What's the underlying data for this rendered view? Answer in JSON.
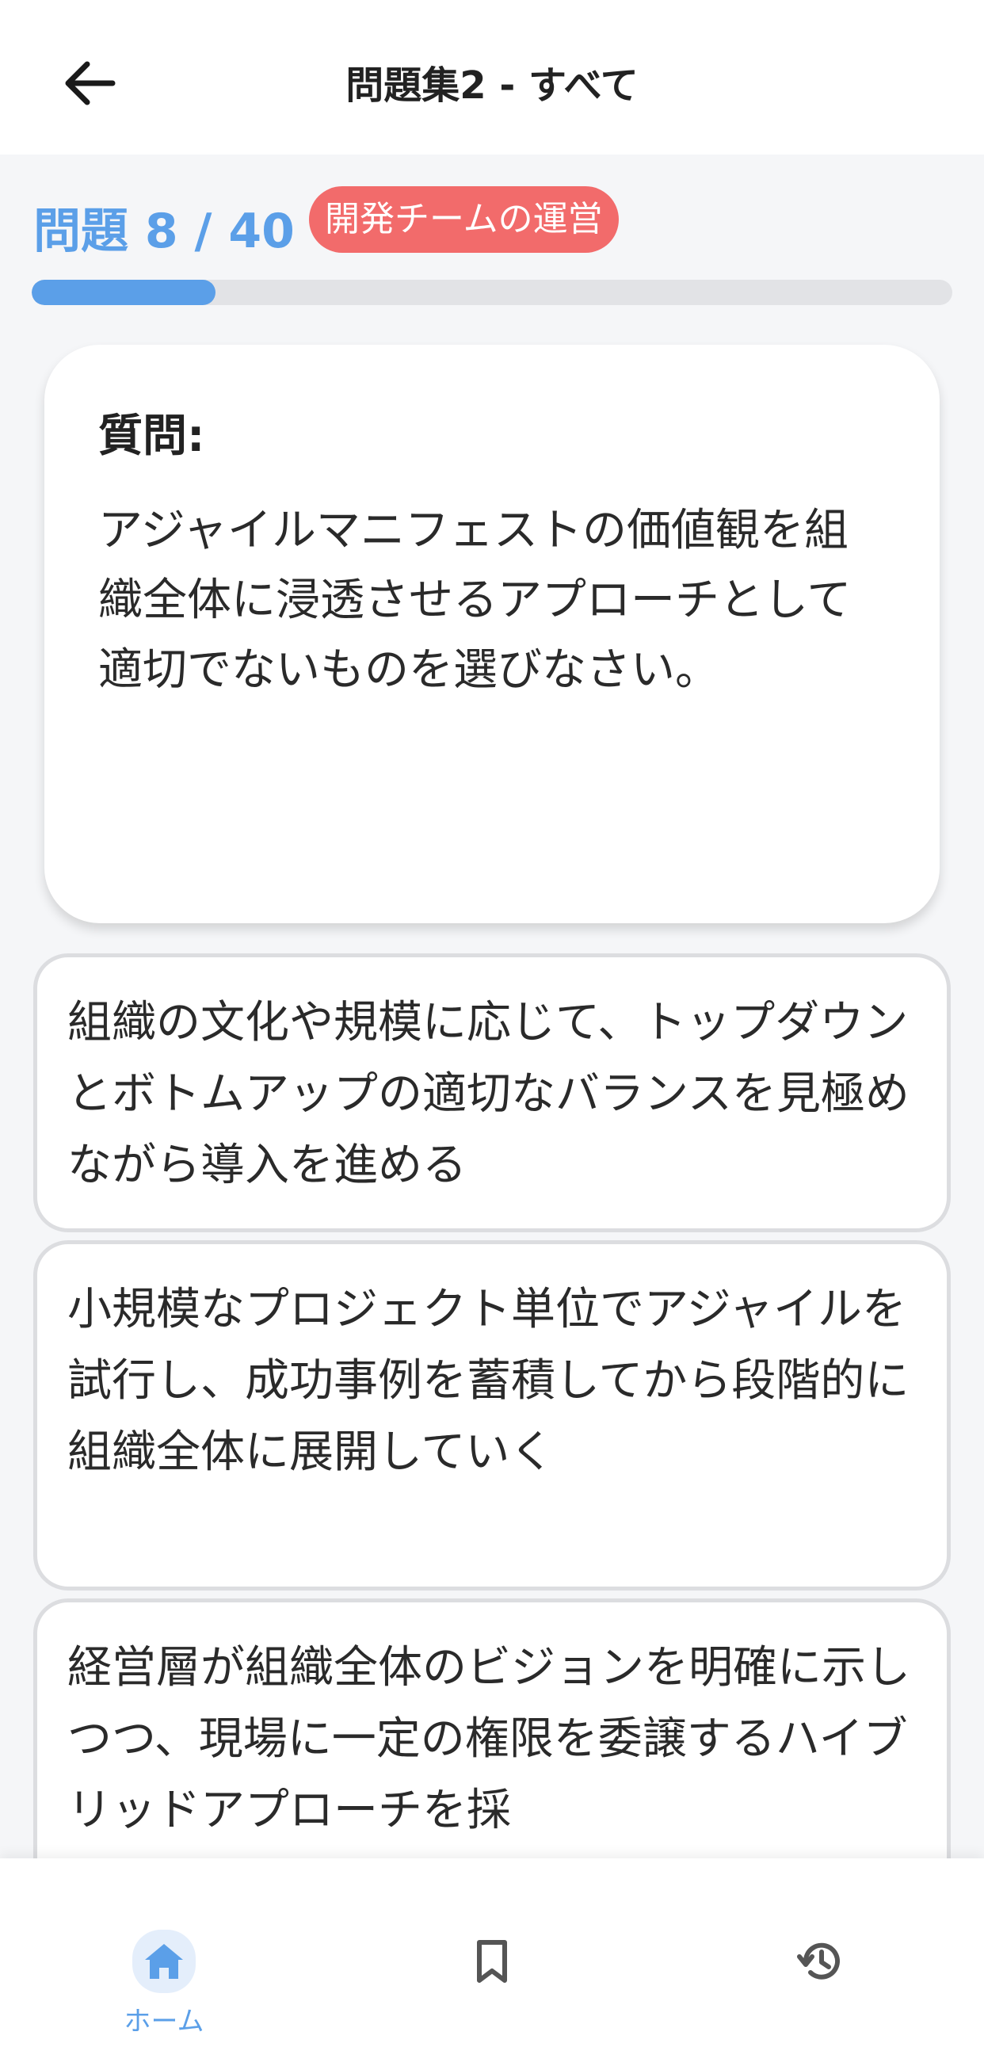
{
  "header": {
    "title": "問題集2 - すべて",
    "icon": "arrow-left-icon"
  },
  "progress": {
    "label": "問題 8 / 40",
    "current": 8,
    "total": 40,
    "fraction": 0.2,
    "color": "#5b9fe8"
  },
  "category_tag": {
    "label": "開発チームの運営",
    "color": "#f26b6b"
  },
  "question": {
    "label": "質問:",
    "text": "アジャイルマニフェストの価値観を組織全体に浸透させるアプローチとして適切でないものを選びなさい。"
  },
  "answers": [
    {
      "text": "組織の文化や規模に応じて、トップダウンとボトムアップの適切なバランスを見極めながら導入を進める"
    },
    {
      "text": "小規模なプロジェクト単位でアジャイルを試行し、成功事例を蓄積してから段階的に組織全体に展開していく"
    },
    {
      "text": "経営層が組織全体のビジョンを明確に示しつつ、現場に一定の権限を委譲するハイブリッドアプローチを採"
    }
  ],
  "tabbar": {
    "active_color": "#5b9fe8",
    "items": [
      {
        "label": "ホーム",
        "icon": "home-icon",
        "active": true
      },
      {
        "label": "",
        "icon": "bookmark-icon",
        "active": false
      },
      {
        "label": "",
        "icon": "history-icon",
        "active": false
      }
    ]
  }
}
